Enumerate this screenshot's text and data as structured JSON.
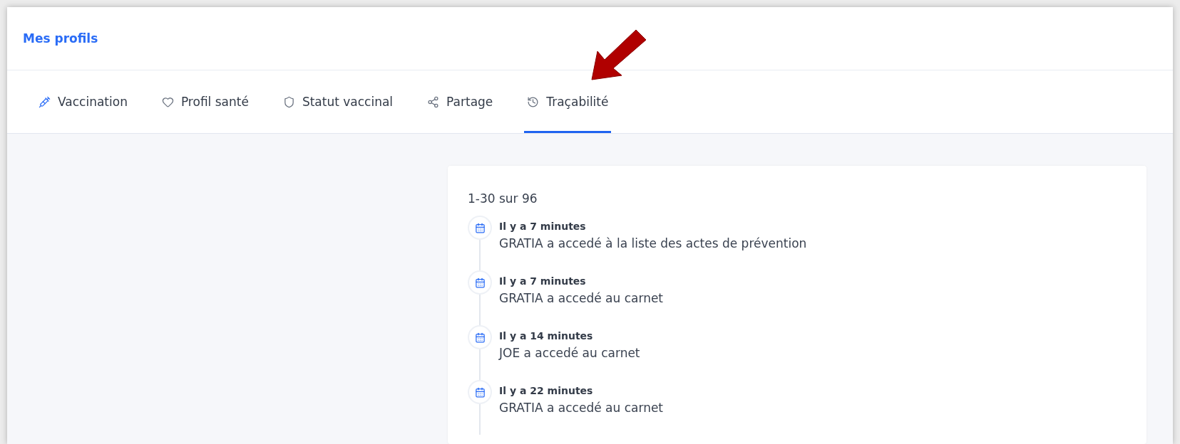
{
  "header": {
    "title": "Mes profils"
  },
  "tabs": [
    {
      "label": "Vaccination",
      "selected": false
    },
    {
      "label": "Profil santé",
      "selected": false
    },
    {
      "label": "Statut vaccinal",
      "selected": false
    },
    {
      "label": "Partage",
      "selected": false
    },
    {
      "label": "Traçabilité",
      "selected": true
    }
  ],
  "log": {
    "range": "1-30 sur 96",
    "entries": [
      {
        "time": "Il y a 7 minutes",
        "text": "GRATIA a accedé à la liste des actes de prévention"
      },
      {
        "time": "Il y a 7 minutes",
        "text": "GRATIA a accedé au carnet"
      },
      {
        "time": "Il y a 14 minutes",
        "text": "JOE a accedé au carnet"
      },
      {
        "time": "Il y a 22 minutes",
        "text": "GRATIA a accedé au carnet"
      }
    ]
  }
}
